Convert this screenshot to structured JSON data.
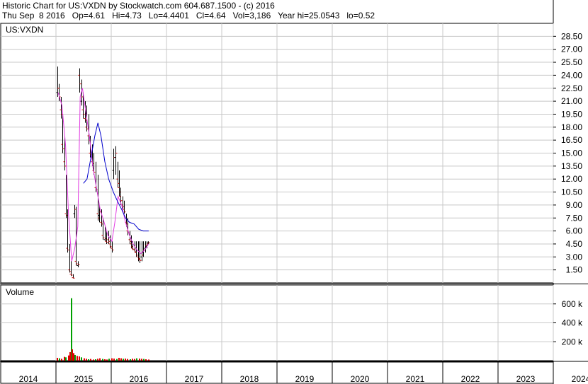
{
  "header": {
    "title_line": "Historic Chart for US:VXDN by Stockwatch.com 604.687.1500 - (c) 2016",
    "quote_line": "Thu Sep  8 2016   Op=4.61   Hi=4.73   Lo=4.4401   Cl=4.64   Vol=3,186   Year hi=25.0543   lo=0.52"
  },
  "chart_data": [
    {
      "type": "candlestick",
      "title": "US:VXDN",
      "ylim": [
        0,
        30
      ],
      "y_ticks": [
        "1.50",
        "3.00",
        "4.50",
        "6.00",
        "7.50",
        "9.00",
        "10.50",
        "12.00",
        "13.50",
        "15.00",
        "16.50",
        "18.00",
        "19.50",
        "21.00",
        "22.50",
        "24.00",
        "25.50",
        "27.00",
        "28.50"
      ],
      "x_ticks": [
        "2014",
        "2015",
        "2016",
        "2017",
        "2018",
        "2019",
        "2020",
        "2021",
        "2022",
        "2023",
        "2024"
      ],
      "grid": true,
      "series": [
        {
          "kind": "price_bars",
          "x": [
            "2015-01-10",
            "2015-01-20",
            "2015-02-01",
            "2015-02-12",
            "2015-02-24",
            "2015-03-06",
            "2015-03-18",
            "2015-03-30",
            "2015-04-10",
            "2015-04-22",
            "2015-05-04",
            "2015-05-14",
            "2015-05-26",
            "2015-06-06",
            "2015-06-17",
            "2015-06-28",
            "2015-07-10",
            "2015-07-22",
            "2015-08-03",
            "2015-08-15",
            "2015-08-27",
            "2015-09-08",
            "2015-09-20",
            "2015-10-02",
            "2015-10-14",
            "2015-10-26",
            "2015-11-07",
            "2015-11-19",
            "2015-12-01",
            "2015-12-13",
            "2015-12-24",
            "2016-01-06",
            "2016-01-17",
            "2016-01-29",
            "2016-02-10",
            "2016-02-21",
            "2016-03-04",
            "2016-03-15",
            "2016-03-27",
            "2016-04-08",
            "2016-04-19",
            "2016-04-30",
            "2016-05-12",
            "2016-05-23",
            "2016-06-04",
            "2016-06-15",
            "2016-06-27",
            "2016-07-08",
            "2016-07-20",
            "2016-07-31",
            "2016-08-12",
            "2016-08-23",
            "2016-09-03"
          ],
          "high": [
            25.0,
            23.0,
            21.5,
            19.5,
            17.0,
            12.5,
            8.5,
            4.5,
            2.5,
            1.0,
            9.0,
            8.8,
            2.5,
            24.8,
            23.5,
            22.0,
            21.0,
            20.5,
            19.5,
            17.0,
            16.0,
            15.0,
            14.0,
            12.5,
            9.0,
            8.5,
            7.5,
            6.5,
            6.0,
            6.0,
            5.5,
            4.8,
            15.5,
            15.8,
            14.0,
            13.0,
            11.0,
            10.0,
            9.5,
            8.0,
            7.5,
            6.0,
            5.5,
            4.8,
            4.8,
            4.8,
            4.8,
            4.8,
            4.8,
            4.8,
            4.8,
            4.8,
            4.8
          ],
          "low": [
            21.5,
            21.0,
            19.0,
            15.0,
            13.0,
            7.5,
            3.5,
            1.2,
            0.8,
            0.52,
            7.5,
            2.0,
            1.8,
            22.0,
            20.5,
            19.0,
            18.5,
            17.5,
            16.0,
            14.5,
            13.5,
            12.5,
            10.5,
            7.2,
            7.0,
            6.5,
            5.0,
            4.8,
            4.5,
            4.5,
            4.0,
            3.5,
            12.0,
            12.5,
            11.0,
            10.0,
            9.0,
            8.5,
            8.0,
            6.5,
            5.5,
            4.5,
            4.0,
            3.8,
            3.5,
            3.0,
            2.5,
            2.3,
            2.5,
            3.0,
            3.5,
            4.0,
            4.4401
          ],
          "open": [
            22.0,
            22.5,
            20.0,
            16.0,
            14.0,
            8.0,
            4.0,
            1.5,
            1.0,
            0.6,
            8.0,
            2.5,
            2.0,
            24.0,
            21.0,
            20.0,
            19.0,
            18.0,
            17.0,
            15.0,
            14.0,
            13.0,
            11.0,
            8.0,
            7.8,
            7.0,
            5.5,
            5.0,
            4.8,
            5.0,
            4.5,
            4.0,
            13.0,
            14.5,
            12.0,
            11.0,
            10.0,
            9.0,
            8.5,
            7.0,
            6.0,
            5.0,
            4.5,
            4.0,
            3.8,
            3.5,
            3.0,
            2.8,
            3.0,
            3.5,
            4.0,
            4.2,
            4.61
          ],
          "close": [
            22.5,
            21.5,
            19.5,
            15.5,
            13.5,
            7.8,
            3.8,
            1.3,
            0.9,
            0.55,
            8.5,
            2.2,
            2.1,
            23.0,
            21.5,
            19.5,
            18.8,
            17.8,
            16.5,
            14.8,
            13.8,
            12.8,
            10.8,
            7.5,
            8.2,
            6.8,
            5.2,
            5.1,
            4.7,
            4.8,
            4.2,
            3.8,
            14.5,
            15.0,
            11.5,
            10.5,
            9.5,
            8.8,
            8.2,
            6.8,
            5.8,
            4.8,
            4.2,
            3.9,
            3.6,
            3.2,
            2.7,
            2.6,
            3.2,
            3.8,
            4.3,
            4.5,
            4.64
          ]
        },
        {
          "kind": "moving_average_short",
          "color": "#e23be2",
          "x": [
            "2015-01-15",
            "2015-02-10",
            "2015-03-05",
            "2015-03-25",
            "2015-04-15",
            "2015-05-05",
            "2015-05-25",
            "2015-06-10",
            "2015-06-25",
            "2015-07-15",
            "2015-08-10",
            "2015-09-01",
            "2015-09-25",
            "2015-10-20",
            "2015-11-15",
            "2015-12-10",
            "2016-01-05",
            "2016-01-25",
            "2016-02-15",
            "2016-03-10",
            "2016-04-05",
            "2016-05-01",
            "2016-05-25",
            "2016-06-20",
            "2016-07-15",
            "2016-08-10",
            "2016-09-05"
          ],
          "y": [
            22.0,
            20.5,
            16.0,
            8.0,
            2.5,
            4.0,
            6.5,
            21.5,
            22.5,
            20.0,
            17.0,
            13.5,
            11.0,
            8.5,
            7.0,
            5.5,
            4.8,
            7.0,
            10.0,
            9.0,
            7.0,
            5.5,
            4.5,
            3.8,
            3.4,
            3.8,
            4.5
          ]
        },
        {
          "kind": "moving_average_long",
          "color": "#0000cc",
          "x": [
            "2015-07-01",
            "2015-07-25",
            "2015-08-20",
            "2015-09-15",
            "2015-10-05",
            "2015-10-25",
            "2015-11-20",
            "2015-12-15",
            "2016-01-15",
            "2016-02-10",
            "2016-03-10",
            "2016-04-05",
            "2016-05-01",
            "2016-06-01",
            "2016-07-01",
            "2016-08-01",
            "2016-09-05"
          ],
          "y": [
            11.5,
            12.0,
            14.5,
            17.0,
            18.5,
            17.0,
            14.0,
            12.0,
            10.5,
            9.5,
            8.5,
            7.5,
            7.0,
            6.8,
            6.2,
            6.0,
            6.0
          ]
        }
      ]
    },
    {
      "type": "bar",
      "title": "Volume",
      "ylim": [
        0,
        800000
      ],
      "y_ticks": [
        "200 k",
        "400 k",
        "600 k"
      ],
      "x": [
        "2015-01-05",
        "2015-01-20",
        "2015-02-05",
        "2015-02-20",
        "2015-03-05",
        "2015-03-20",
        "2015-04-01",
        "2015-04-08",
        "2015-04-15",
        "2015-04-25",
        "2015-05-05",
        "2015-05-15",
        "2015-05-30",
        "2015-06-15",
        "2015-07-01",
        "2015-07-15",
        "2015-08-01",
        "2015-08-15",
        "2015-09-01",
        "2015-09-15",
        "2015-10-01",
        "2015-10-15",
        "2015-11-01",
        "2015-11-15",
        "2015-12-01",
        "2015-12-15",
        "2016-01-01",
        "2016-01-15",
        "2016-02-01",
        "2016-02-15",
        "2016-03-01",
        "2016-03-15",
        "2016-04-01",
        "2016-04-15",
        "2016-05-01",
        "2016-05-15",
        "2016-06-01",
        "2016-06-15",
        "2016-07-01",
        "2016-07-15",
        "2016-08-01",
        "2016-08-15",
        "2016-09-01"
      ],
      "values": [
        30000,
        25000,
        20000,
        40000,
        35000,
        55000,
        90000,
        660000,
        120000,
        80000,
        60000,
        50000,
        45000,
        35000,
        25000,
        20000,
        15000,
        18000,
        12000,
        15000,
        20000,
        25000,
        18000,
        15000,
        12000,
        20000,
        25000,
        22000,
        18000,
        30000,
        25000,
        20000,
        22000,
        18000,
        15000,
        20000,
        18000,
        25000,
        22000,
        20000,
        18000,
        15000,
        12000
      ],
      "colors": [
        "red",
        "green"
      ]
    }
  ]
}
